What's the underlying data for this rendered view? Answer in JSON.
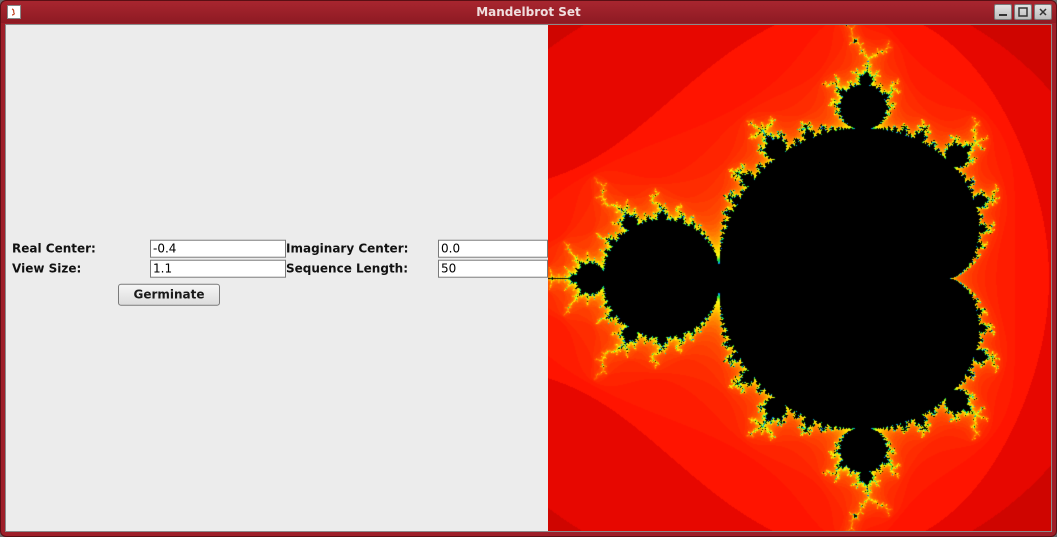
{
  "window": {
    "title": "Mandelbrot Set"
  },
  "form": {
    "real_center_label": "Real Center:",
    "real_center_value": "-0.4",
    "imaginary_center_label": "Imaginary Center:",
    "imaginary_center_value": "0.0",
    "view_size_label": "View Size:",
    "view_size_value": "1.1",
    "sequence_length_label": "Sequence Length:",
    "sequence_length_value": "50",
    "germinate_label": "Germinate"
  },
  "mandelbrot": {
    "real_center": -0.4,
    "imaginary_center": 0.0,
    "view_half_size": 1.1,
    "max_iter": 50
  }
}
